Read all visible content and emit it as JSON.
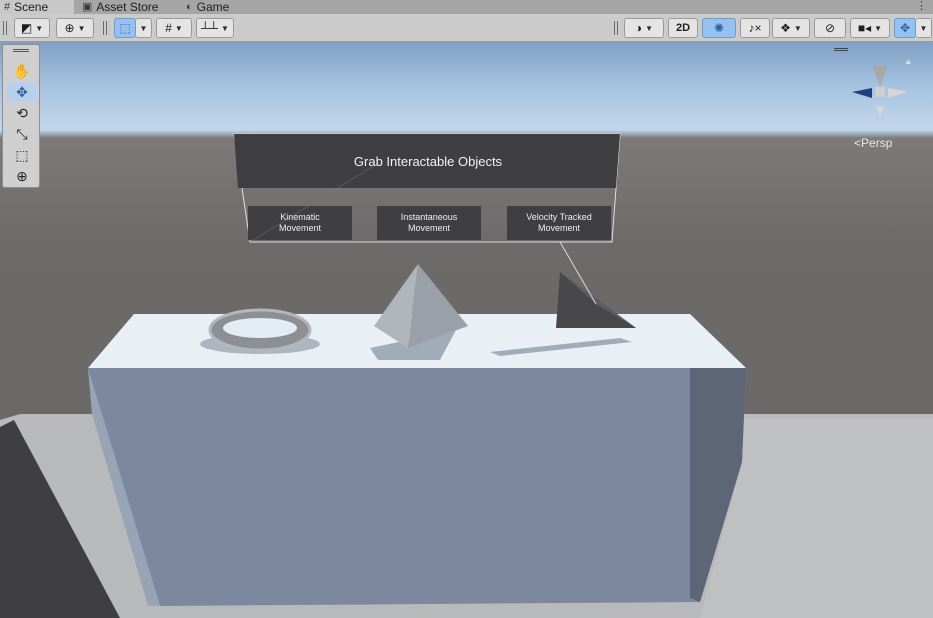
{
  "tabs": [
    {
      "label": "Scene",
      "icon": "grid-icon",
      "active": true
    },
    {
      "label": "Asset Store",
      "icon": "store-icon",
      "active": false
    },
    {
      "label": "Game",
      "icon": "gamepad-icon",
      "active": false
    }
  ],
  "toolbar": {
    "mode_2d_label": "2D"
  },
  "tools": [
    "hand-tool",
    "move-tool",
    "rotate-tool",
    "scale-tool",
    "rect-tool",
    "transform-tool"
  ],
  "selected_tool": "move-tool",
  "gizmo": {
    "projection_label": "Persp"
  },
  "world_ui": {
    "title": "Grab Interactable Objects",
    "buttons": [
      {
        "label": "Kinematic Movement",
        "line1": "Kinematic",
        "line2": "Movement"
      },
      {
        "label": "Instantaneous Movement",
        "line1": "Instantaneous",
        "line2": "Movement"
      },
      {
        "label": "Velocity Tracked Movement",
        "line1": "Velocity Tracked",
        "line2": "Movement"
      }
    ]
  },
  "colors": {
    "selected_accent": "#96c0ee",
    "sky": "#a6c3e0",
    "ground": "#6d6b69",
    "table": "#7b889d",
    "canvas_panel": "#3f3e41"
  }
}
